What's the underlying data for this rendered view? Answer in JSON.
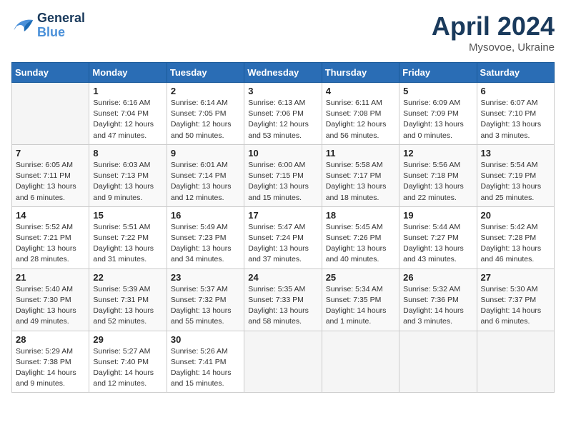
{
  "header": {
    "logo_line1": "General",
    "logo_line2": "Blue",
    "month_title": "April 2024",
    "location": "Mysovoe, Ukraine"
  },
  "weekdays": [
    "Sunday",
    "Monday",
    "Tuesday",
    "Wednesday",
    "Thursday",
    "Friday",
    "Saturday"
  ],
  "weeks": [
    [
      {
        "day": "",
        "info": ""
      },
      {
        "day": "1",
        "info": "Sunrise: 6:16 AM\nSunset: 7:04 PM\nDaylight: 12 hours\nand 47 minutes."
      },
      {
        "day": "2",
        "info": "Sunrise: 6:14 AM\nSunset: 7:05 PM\nDaylight: 12 hours\nand 50 minutes."
      },
      {
        "day": "3",
        "info": "Sunrise: 6:13 AM\nSunset: 7:06 PM\nDaylight: 12 hours\nand 53 minutes."
      },
      {
        "day": "4",
        "info": "Sunrise: 6:11 AM\nSunset: 7:08 PM\nDaylight: 12 hours\nand 56 minutes."
      },
      {
        "day": "5",
        "info": "Sunrise: 6:09 AM\nSunset: 7:09 PM\nDaylight: 13 hours\nand 0 minutes."
      },
      {
        "day": "6",
        "info": "Sunrise: 6:07 AM\nSunset: 7:10 PM\nDaylight: 13 hours\nand 3 minutes."
      }
    ],
    [
      {
        "day": "7",
        "info": "Sunrise: 6:05 AM\nSunset: 7:11 PM\nDaylight: 13 hours\nand 6 minutes."
      },
      {
        "day": "8",
        "info": "Sunrise: 6:03 AM\nSunset: 7:13 PM\nDaylight: 13 hours\nand 9 minutes."
      },
      {
        "day": "9",
        "info": "Sunrise: 6:01 AM\nSunset: 7:14 PM\nDaylight: 13 hours\nand 12 minutes."
      },
      {
        "day": "10",
        "info": "Sunrise: 6:00 AM\nSunset: 7:15 PM\nDaylight: 13 hours\nand 15 minutes."
      },
      {
        "day": "11",
        "info": "Sunrise: 5:58 AM\nSunset: 7:17 PM\nDaylight: 13 hours\nand 18 minutes."
      },
      {
        "day": "12",
        "info": "Sunrise: 5:56 AM\nSunset: 7:18 PM\nDaylight: 13 hours\nand 22 minutes."
      },
      {
        "day": "13",
        "info": "Sunrise: 5:54 AM\nSunset: 7:19 PM\nDaylight: 13 hours\nand 25 minutes."
      }
    ],
    [
      {
        "day": "14",
        "info": "Sunrise: 5:52 AM\nSunset: 7:21 PM\nDaylight: 13 hours\nand 28 minutes."
      },
      {
        "day": "15",
        "info": "Sunrise: 5:51 AM\nSunset: 7:22 PM\nDaylight: 13 hours\nand 31 minutes."
      },
      {
        "day": "16",
        "info": "Sunrise: 5:49 AM\nSunset: 7:23 PM\nDaylight: 13 hours\nand 34 minutes."
      },
      {
        "day": "17",
        "info": "Sunrise: 5:47 AM\nSunset: 7:24 PM\nDaylight: 13 hours\nand 37 minutes."
      },
      {
        "day": "18",
        "info": "Sunrise: 5:45 AM\nSunset: 7:26 PM\nDaylight: 13 hours\nand 40 minutes."
      },
      {
        "day": "19",
        "info": "Sunrise: 5:44 AM\nSunset: 7:27 PM\nDaylight: 13 hours\nand 43 minutes."
      },
      {
        "day": "20",
        "info": "Sunrise: 5:42 AM\nSunset: 7:28 PM\nDaylight: 13 hours\nand 46 minutes."
      }
    ],
    [
      {
        "day": "21",
        "info": "Sunrise: 5:40 AM\nSunset: 7:30 PM\nDaylight: 13 hours\nand 49 minutes."
      },
      {
        "day": "22",
        "info": "Sunrise: 5:39 AM\nSunset: 7:31 PM\nDaylight: 13 hours\nand 52 minutes."
      },
      {
        "day": "23",
        "info": "Sunrise: 5:37 AM\nSunset: 7:32 PM\nDaylight: 13 hours\nand 55 minutes."
      },
      {
        "day": "24",
        "info": "Sunrise: 5:35 AM\nSunset: 7:33 PM\nDaylight: 13 hours\nand 58 minutes."
      },
      {
        "day": "25",
        "info": "Sunrise: 5:34 AM\nSunset: 7:35 PM\nDaylight: 14 hours\nand 1 minute."
      },
      {
        "day": "26",
        "info": "Sunrise: 5:32 AM\nSunset: 7:36 PM\nDaylight: 14 hours\nand 3 minutes."
      },
      {
        "day": "27",
        "info": "Sunrise: 5:30 AM\nSunset: 7:37 PM\nDaylight: 14 hours\nand 6 minutes."
      }
    ],
    [
      {
        "day": "28",
        "info": "Sunrise: 5:29 AM\nSunset: 7:38 PM\nDaylight: 14 hours\nand 9 minutes."
      },
      {
        "day": "29",
        "info": "Sunrise: 5:27 AM\nSunset: 7:40 PM\nDaylight: 14 hours\nand 12 minutes."
      },
      {
        "day": "30",
        "info": "Sunrise: 5:26 AM\nSunset: 7:41 PM\nDaylight: 14 hours\nand 15 minutes."
      },
      {
        "day": "",
        "info": ""
      },
      {
        "day": "",
        "info": ""
      },
      {
        "day": "",
        "info": ""
      },
      {
        "day": "",
        "info": ""
      }
    ]
  ]
}
